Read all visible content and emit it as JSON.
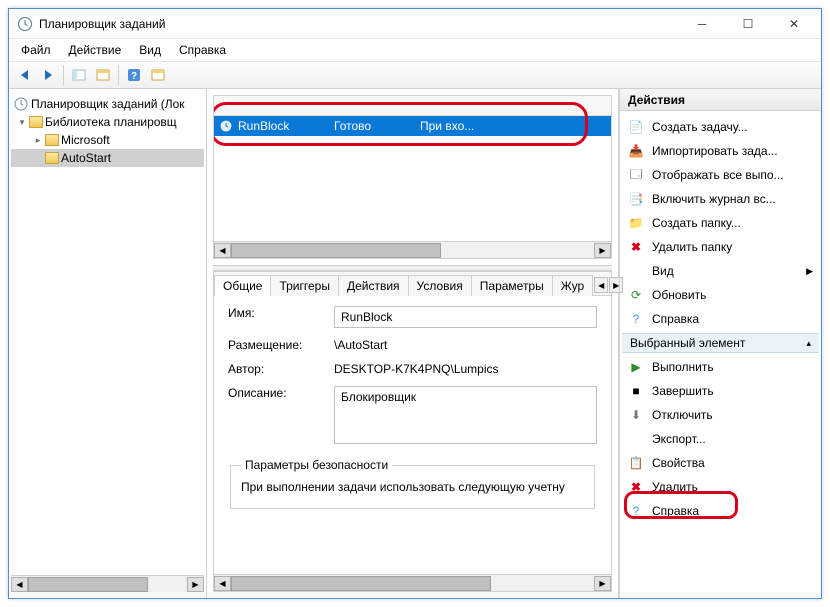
{
  "window": {
    "title": "Планировщик заданий"
  },
  "menu": {
    "file": "Файл",
    "action": "Действие",
    "view": "Вид",
    "help": "Справка"
  },
  "tree": {
    "root": "Планировщик заданий (Лок",
    "library": "Библиотека планировщ",
    "microsoft": "Microsoft",
    "autostart": "AutoStart"
  },
  "task": {
    "name": "RunBlock",
    "state": "Готово",
    "trigger": "При вхо..."
  },
  "tabs": {
    "general": "Общие",
    "triggers": "Триггеры",
    "actions": "Действия",
    "conditions": "Условия",
    "params": "Параметры",
    "journal": "Жур"
  },
  "form": {
    "name_label": "Имя:",
    "name_value": "RunBlock",
    "loc_label": "Размещение:",
    "loc_value": "\\AutoStart",
    "author_label": "Автор:",
    "author_value": "DESKTOP-K7K4PNQ\\Lumpics",
    "desc_label": "Описание:",
    "desc_value": "Блокировщик",
    "security_legend": "Параметры безопасности",
    "security_text": "При выполнении задачи использовать следующую учетну"
  },
  "actions": {
    "header": "Действия",
    "create_task": "Создать задачу...",
    "import_task": "Импортировать зада...",
    "show_running": "Отображать все выпо...",
    "enable_log": "Включить журнал вс...",
    "new_folder": "Создать папку...",
    "del_folder": "Удалить папку",
    "view": "Вид",
    "refresh": "Обновить",
    "help": "Справка",
    "selected_header": "Выбранный элемент",
    "run": "Выполнить",
    "end": "Завершить",
    "disable": "Отключить",
    "export": "Экспорт...",
    "props": "Свойства",
    "delete": "Удалить",
    "help2": "Справка"
  }
}
